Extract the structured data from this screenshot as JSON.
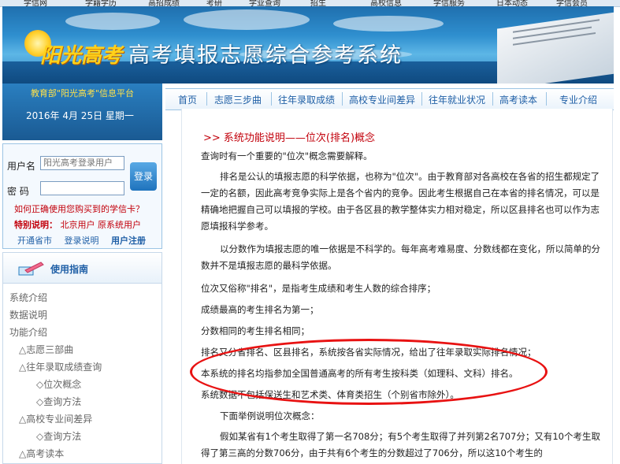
{
  "top_menu": [
    "学信网",
    "学籍学历",
    "高招成绩",
    "考研",
    "学业查询",
    "招生",
    "高校信息",
    "学信服务",
    "日本动态",
    "学信会员"
  ],
  "banner": {
    "logo": "阳光高考",
    "title": "高考填报志愿综合参考系统"
  },
  "sidebar": {
    "platform": "教育部\"阳光高考\"信息平台",
    "date": "2016年  4月  25日    星期一"
  },
  "login": {
    "username_label": "用户名",
    "username_placeholder": "阳光高考登录用户",
    "password_label": "密  码",
    "login_button": "登录",
    "help_link": "如何正确使用您购买到的学信卡？",
    "special_title": "特别说明：",
    "special_users": "北京用户   原系统用户",
    "links": [
      "开通省市",
      "登录说明",
      "用户注册"
    ]
  },
  "guide": {
    "title": "使用指南",
    "items": [
      "系统介绍",
      "数据说明",
      "功能介绍",
      "△志愿三部曲",
      "△往年录取成绩查询",
      "◇位次概念",
      "◇查询方法",
      "△高校专业间差异",
      "◇查询方法",
      "△高考读本"
    ]
  },
  "nav": {
    "items": [
      "首页",
      "志愿三步曲",
      "往年录取成绩",
      "高校专业间差异",
      "往年就业状况",
      "高考读本",
      "专业介绍"
    ]
  },
  "content": {
    "section_title": ">> 系统功能说明——位次(排名)概念",
    "paragraphs": [
      "查询时有一个重要的\"位次\"概念需要解释。",
      "排名是公认的填报志愿的科学依据，也称为\"位次\"。由于教育部对各高校在各省的招生都规定了一定的名额，因此高考竞争实际上是各个省内的竞争。因此考生根据自己在本省的排名情况，可以是精确地把握自己可以填报的学校。由于各区县的教学整体实力相对稳定，所以区县排名也可以作为志愿填报科学参考。",
      "以分数作为填报志愿的唯一依据是不科学的。每年高考难易度、分数线都在变化，所以简单的分数并不是填报志愿的最科学依据。",
      "位次又俗称\"排名\"，是指考生成绩和考生人数的综合排序；",
      "成绩最高的考生排名为第一；",
      "分数相同的考生排名相同；",
      "排名又分省排名、区县排名，系统按各省实际情况，给出了往年录取实际排名情况；",
      "本系统的排名均指参加全国普通高考的所有考生按科类（如理科、文科）排名。",
      "系统数据不包括保送生和艺术类、体育类招生（个别省市除外）。",
      "下面举例说明位次概念：",
      "假如某省有1个考生取得了第一名708分；有5个考生取得了并列第2名707分；又有10个考生取得了第三高的分数706分，由于共有6个考生的分数超过了706分，所以这10个考生的"
    ]
  },
  "colors": {
    "accent": "#1f5fa6",
    "red": "#c2000b",
    "highlight": "#e81212"
  }
}
